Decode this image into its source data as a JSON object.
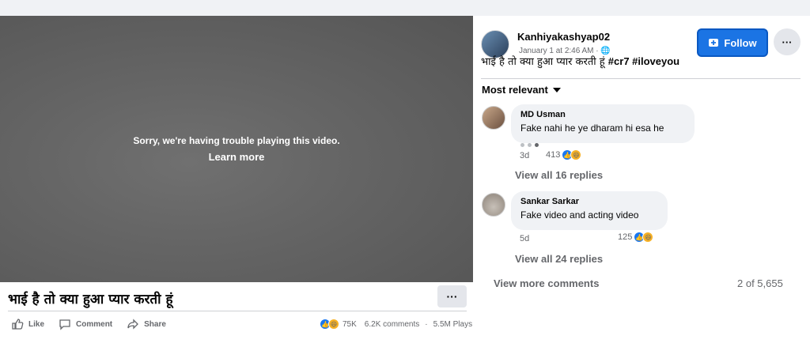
{
  "video": {
    "error_text": "Sorry, we're having trouble playing this video.",
    "learn_more": "Learn more",
    "caption": "भाई है तो क्या हुआ प्यार करती हूं",
    "more_label": "···"
  },
  "actions": {
    "like": "Like",
    "comment": "Comment",
    "share": "Share"
  },
  "stats": {
    "reactions": "75K",
    "comments": "6.2K comments",
    "plays": "5.5M Plays",
    "separator": "·"
  },
  "post": {
    "author": "Kanhiyakashyap02",
    "time": "January 1 at 2:46 AM · ",
    "text_hindi": "भाई है तो क्या हुआ प्यार करती हूं ",
    "hashtags": "#cr7 #iloveyou",
    "follow_label": "Follow",
    "more_label": "···"
  },
  "comments_header": {
    "sort_label": "Most relevant"
  },
  "comments": [
    {
      "name": "MD Usman",
      "text": "Fake nahi he ye dharam hi esa he",
      "age": "3d",
      "reactions": "413",
      "replies": "View all 16 replies"
    },
    {
      "name": "Sankar Sarkar",
      "text": "Fake video and acting video",
      "age": "5d",
      "reactions": "125",
      "replies": "View all 24 replies"
    }
  ],
  "footer": {
    "view_more": "View more comments",
    "count": "2 of 5,655"
  },
  "colors": {
    "accent": "#1b74e4",
    "like_blue": "#1877f2",
    "haha_yellow": "#f7b125"
  }
}
